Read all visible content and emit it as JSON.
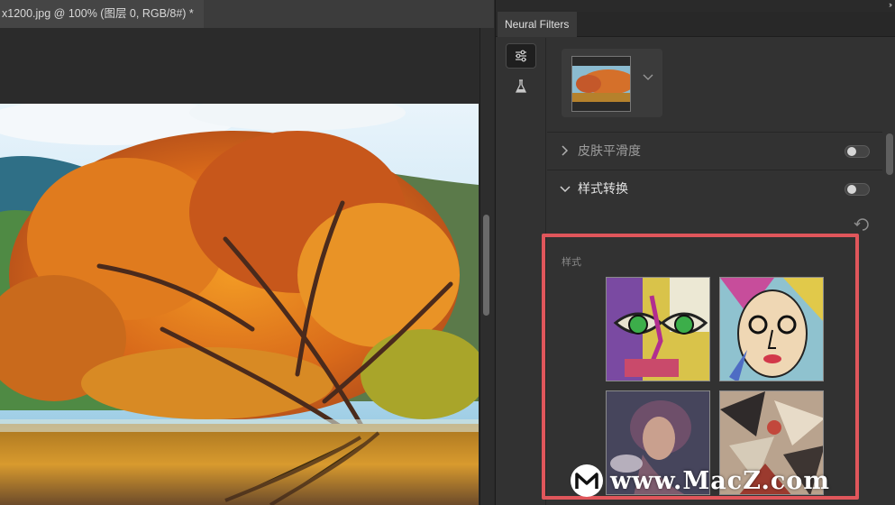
{
  "document": {
    "tab_title": "x1200.jpg @ 100% (图层 0, RGB/8#) *"
  },
  "panel": {
    "tab_label": "Neural Filters",
    "collapse_icon": "double-chevron-right-icon",
    "tools": [
      {
        "name": "sliders-icon",
        "active": true
      },
      {
        "name": "flask-icon",
        "active": false
      }
    ],
    "filters": [
      {
        "label": "皮肤平滑度",
        "expanded": false,
        "enabled": false
      },
      {
        "label": "样式转换",
        "expanded": true,
        "enabled": false
      }
    ],
    "style_section_label": "样式",
    "style_thumbs": [
      {
        "name": "style-thumb-1"
      },
      {
        "name": "style-thumb-2"
      },
      {
        "name": "style-thumb-3"
      },
      {
        "name": "style-thumb-4"
      }
    ]
  },
  "overlay": {
    "highlight_color": "#e0565b",
    "watermark_text": "www.MacZ.com"
  },
  "colors": {
    "panel_bg": "#323232",
    "tab_bg": "#3a3a3a",
    "canvas_bg": "#262626"
  }
}
